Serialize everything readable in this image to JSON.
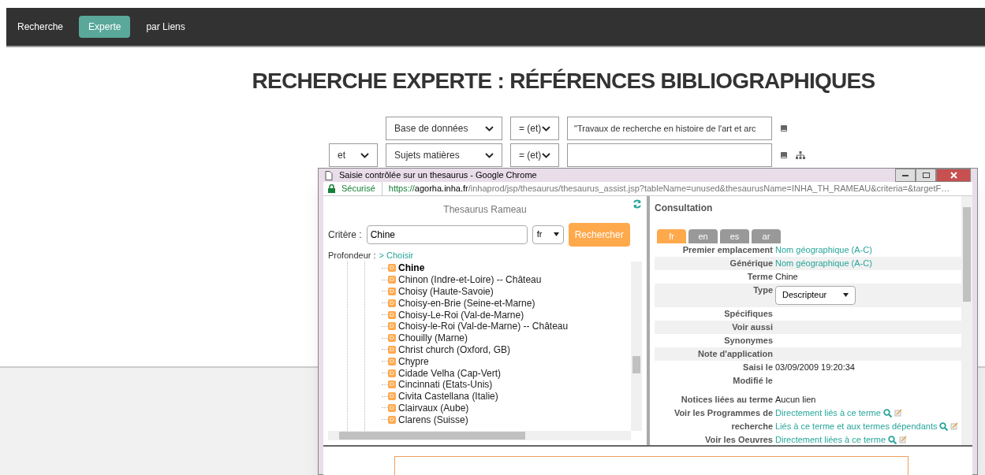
{
  "nav": [
    {
      "label": "Recherche",
      "selected": false
    },
    {
      "label": "Experte",
      "selected": true
    },
    {
      "label": "par Liens",
      "selected": false
    }
  ],
  "title": "RECHERCHE EXPERTE : RÉFÉRENCES BIBLIOGRAPHIQUES",
  "criteria_rows": [
    {
      "operator": null,
      "field": "Base de données",
      "comparator": "= (et)",
      "value": "\"Travaux de recherche en histoire de l'art et arc",
      "tree_icon": false
    },
    {
      "operator": "et",
      "field": "Sujets matières",
      "comparator": "= (et)",
      "value": "",
      "tree_icon": true
    }
  ],
  "popup": {
    "window_title": "Saisie contrôlée sur un thesaurus - Google Chrome",
    "security": "Sécurisé",
    "url_scheme": "https://",
    "url_host": "agorha.inha.fr",
    "url_path": "/inhaprod/jsp/thesaurus/thesaurus_assist.jsp?tableName=unused&thesaurusName=INHA_TH_RAMEAU&criteria=&targetF…",
    "thesaurus": {
      "title": "Thesaurus Rameau",
      "criteria_label": "Critère :",
      "criteria_value": "Chine",
      "language": "fr",
      "search_button": "Rechercher",
      "depth_label": "Profondeur :",
      "depth_link": "> Choisir",
      "items": [
        {
          "badge": "D",
          "label": "Chine",
          "selected": true
        },
        {
          "badge": "D",
          "label": "Chinon (Indre-et-Loire) -- Château",
          "selected": false
        },
        {
          "badge": "D",
          "label": "Choisy (Haute-Savoie)",
          "selected": false
        },
        {
          "badge": "D",
          "label": "Choisy-en-Brie (Seine-et-Marne)",
          "selected": false
        },
        {
          "badge": "D",
          "label": "Choisy-Le-Roi (Val-de-Marne)",
          "selected": false
        },
        {
          "badge": "D",
          "label": "Choisy-le-Roi (Val-de-Marne) -- Château",
          "selected": false
        },
        {
          "badge": "D",
          "label": "Chouilly (Marne)",
          "selected": false
        },
        {
          "badge": "D",
          "label": "Christ church (Oxford, GB)",
          "selected": false
        },
        {
          "badge": "D",
          "label": "Chypre",
          "selected": false
        },
        {
          "badge": "D",
          "label": "Cidade Velha (Cap-Vert)",
          "selected": false
        },
        {
          "badge": "D",
          "label": "Cincinnati (Etats-Unis)",
          "selected": false
        },
        {
          "badge": "D",
          "label": "Civita Castellana (Italie)",
          "selected": false
        },
        {
          "badge": "D",
          "label": "Clairvaux (Aube)",
          "selected": false
        },
        {
          "badge": "D",
          "label": "Clarens (Suisse)",
          "selected": false
        }
      ]
    },
    "consultation": {
      "title": "Consultation",
      "tabs": [
        {
          "label": "fr",
          "selected": true
        },
        {
          "label": "en",
          "selected": false
        },
        {
          "label": "es",
          "selected": false
        },
        {
          "label": "ar",
          "selected": false
        }
      ],
      "rows": [
        {
          "label": "Premier emplacement",
          "kind": "link",
          "value": "Nom géographique (A-C)"
        },
        {
          "label": "Générique",
          "kind": "link",
          "value": "Nom géographique (A-C)"
        },
        {
          "label": "Terme",
          "kind": "text",
          "value": "Chine"
        },
        {
          "label": "Type",
          "kind": "select",
          "value": "Descripteur"
        },
        {
          "label": "Spécifiques",
          "kind": "text",
          "value": ""
        },
        {
          "label": "Voir aussi",
          "kind": "text",
          "value": ""
        },
        {
          "label": "Synonymes",
          "kind": "text",
          "value": ""
        },
        {
          "label": "Note d'application",
          "kind": "text",
          "value": ""
        },
        {
          "label": "Saisi le",
          "kind": "text",
          "value": "03/09/2009 19:20:34"
        },
        {
          "label": "Modifié le",
          "kind": "text",
          "value": ""
        },
        {
          "label": "Notices liées au terme",
          "kind": "text",
          "value": "Aucun lien"
        },
        {
          "label": "Voir les Programmes de recherche",
          "kind": "links",
          "links": [
            "Directement liés à ce terme",
            "Liés à ce terme et aux termes dépendants"
          ]
        },
        {
          "label": "Voir les Oeuvres",
          "kind": "links",
          "links": [
            "Directement liées à ce terme"
          ]
        }
      ]
    }
  }
}
